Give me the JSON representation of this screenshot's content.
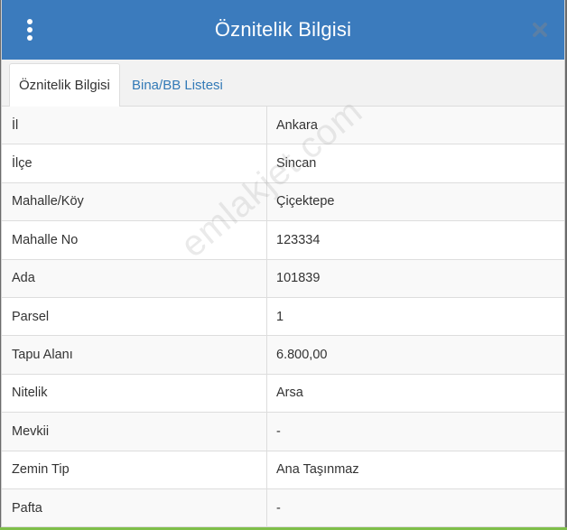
{
  "dialog": {
    "title": "Öznitelik Bilgisi",
    "menu_icon": "vertical-ellipsis-icon",
    "close_icon": "close-icon"
  },
  "tabs": [
    {
      "label": "Öznitelik Bilgisi",
      "active": true
    },
    {
      "label": "Bina/BB Listesi",
      "active": false
    }
  ],
  "rows": [
    {
      "label": "İl",
      "value": "Ankara"
    },
    {
      "label": "İlçe",
      "value": "Sincan"
    },
    {
      "label": "Mahalle/Köy",
      "value": "Çiçektepe"
    },
    {
      "label": "Mahalle No",
      "value": "123334"
    },
    {
      "label": "Ada",
      "value": "101839"
    },
    {
      "label": "Parsel",
      "value": "1"
    },
    {
      "label": "Tapu Alanı",
      "value": "6.800,00"
    },
    {
      "label": "Nitelik",
      "value": "Arsa"
    },
    {
      "label": "Mevkii",
      "value": "-"
    },
    {
      "label": "Zemin Tip",
      "value": "Ana Taşınmaz"
    },
    {
      "label": "Pafta",
      "value": "-"
    }
  ],
  "watermark": "emlakjet.com",
  "colors": {
    "header_bg": "#3b7bbd",
    "tab_link": "#337ab7",
    "close_icon": "#5a7fa6"
  }
}
